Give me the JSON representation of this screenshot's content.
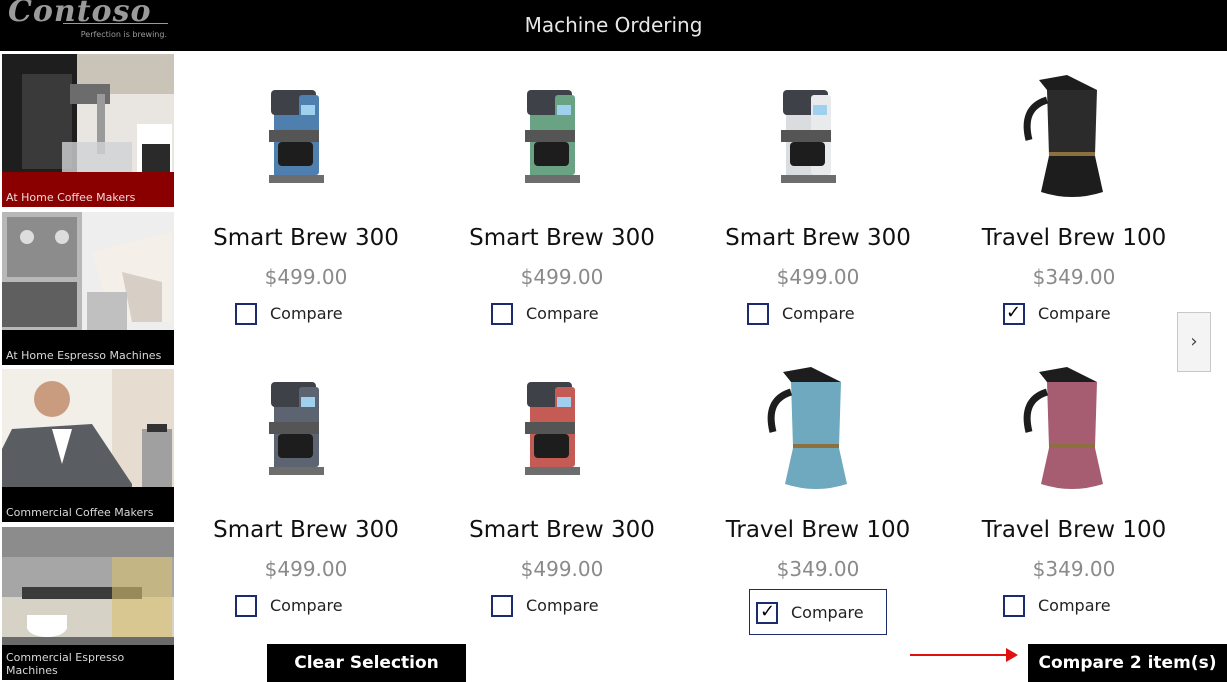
{
  "header": {
    "brand": "Contoso",
    "tagline": "Perfection is brewing.",
    "title": "Machine Ordering"
  },
  "sidebar": {
    "items": [
      {
        "label": "At Home Coffee Makers",
        "active": true
      },
      {
        "label": "At Home Espresso Machines",
        "active": false
      },
      {
        "label": "Commercial Coffee Makers",
        "active": false
      },
      {
        "label": "Commercial Espresso Machines",
        "active": false
      }
    ]
  },
  "products": [
    {
      "name": "Smart Brew 300",
      "price": "$499.00",
      "compare_label": "Compare",
      "checked": false,
      "color": "#4f7fae"
    },
    {
      "name": "Smart Brew 300",
      "price": "$499.00",
      "compare_label": "Compare",
      "checked": false,
      "color": "#6aa383"
    },
    {
      "name": "Smart Brew 300",
      "price": "$499.00",
      "compare_label": "Compare",
      "checked": false,
      "color": "#d9dde0"
    },
    {
      "name": "Travel Brew 100",
      "price": "$349.00",
      "compare_label": "Compare",
      "checked": true,
      "color": "#2b2b2b"
    },
    {
      "name": "Smart Brew 300",
      "price": "$499.00",
      "compare_label": "Compare",
      "checked": false,
      "color": "#5b6470"
    },
    {
      "name": "Smart Brew 300",
      "price": "$499.00",
      "compare_label": "Compare",
      "checked": false,
      "color": "#c45b55"
    },
    {
      "name": "Travel Brew 100",
      "price": "$349.00",
      "compare_label": "Compare",
      "checked": true,
      "color": "#6fa9bf"
    },
    {
      "name": "Travel Brew 100",
      "price": "$349.00",
      "compare_label": "Compare",
      "checked": false,
      "color": "#a65d72"
    }
  ],
  "next_icon": "chevron-right-icon",
  "actions": {
    "clear_label": "Clear Selection",
    "compare_label": "Compare 2 item(s)"
  },
  "colors": {
    "header_bg": "#000000",
    "active_category": "#8a0000",
    "checkbox_border": "#1c2a6e",
    "arrow": "#e01010"
  }
}
